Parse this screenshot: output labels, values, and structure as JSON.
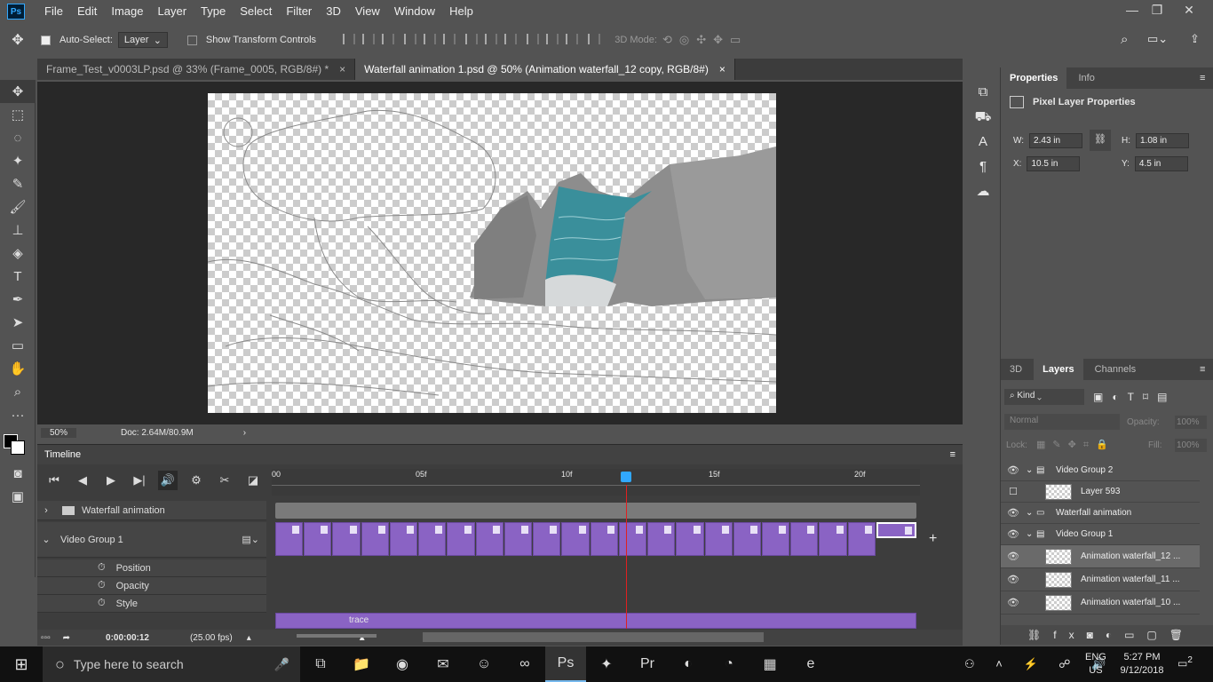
{
  "app": {
    "logo": "Ps"
  },
  "menu": [
    "File",
    "Edit",
    "Image",
    "Layer",
    "Type",
    "Select",
    "Filter",
    "3D",
    "View",
    "Window",
    "Help"
  ],
  "options": {
    "auto_select_label": "Auto-Select:",
    "auto_select_value": "Layer",
    "transform_label": "Show Transform Controls",
    "mode_label": "3D Mode:"
  },
  "tabs": [
    {
      "label": "Frame_Test_v0003LP.psd @ 33% (Frame_0005, RGB/8#) *",
      "close": "×"
    },
    {
      "label": "Waterfall animation 1.psd @ 50% (Animation waterfall_12 copy, RGB/8#)",
      "close": "×"
    }
  ],
  "status": {
    "zoom": "50%",
    "doc": "Doc: 2.64M/80.9M"
  },
  "timeline": {
    "title": "Timeline",
    "ruler": [
      "00",
      "05f",
      "10f",
      "15f",
      "20f"
    ],
    "tracks": {
      "group1": "Waterfall animation",
      "group2": "Video Group 1",
      "prop1": "Position",
      "prop2": "Opacity",
      "prop3": "Style",
      "trace": "trace"
    },
    "timecode": "0:00:00:12",
    "fps": "(25.00 fps)",
    "current_frame": 12,
    "total_frames": 22
  },
  "properties": {
    "tab1": "Properties",
    "tab2": "Info",
    "title": "Pixel Layer Properties",
    "w_label": "W:",
    "w": "2.43 in",
    "h_label": "H:",
    "h": "1.08 in",
    "x_label": "X:",
    "x": "10.5 in",
    "y_label": "Y:",
    "y": "4.5 in"
  },
  "layers_panel": {
    "tabs": [
      "3D",
      "Layers",
      "Channels"
    ],
    "kind": "Kind",
    "blend": "Normal",
    "opacity_label": "Opacity:",
    "opacity": "100%",
    "lock_label": "Lock:",
    "fill_label": "Fill:",
    "fill": "100%",
    "layers": [
      {
        "name": "Video Group 2",
        "type": "video"
      },
      {
        "name": "Layer 593",
        "type": "pixel"
      },
      {
        "name": "Waterfall animation",
        "type": "folder"
      },
      {
        "name": "Video Group 1",
        "type": "video"
      },
      {
        "name": "Animation waterfall_12 ...",
        "type": "pixel"
      },
      {
        "name": "Animation waterfall_11 ...",
        "type": "pixel"
      },
      {
        "name": "Animation waterfall_10 ...",
        "type": "pixel"
      }
    ]
  },
  "taskbar": {
    "search_placeholder": "Type here to search",
    "lang1": "ENG",
    "lang2": "US",
    "time": "5:27 PM",
    "date": "9/12/2018",
    "notif": "2"
  },
  "colors": {
    "accent_teal": "#3a8f9b",
    "frame_purple": "#8a63c4",
    "playhead": "#e02020"
  }
}
